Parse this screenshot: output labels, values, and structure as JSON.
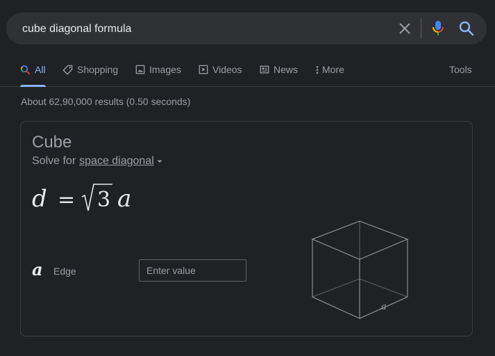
{
  "search": {
    "query": "cube diagonal formula"
  },
  "tabs": [
    {
      "label": "All",
      "icon": "search-icon",
      "active": true
    },
    {
      "label": "Shopping",
      "icon": "tag-icon",
      "active": false
    },
    {
      "label": "Images",
      "icon": "image-icon",
      "active": false
    },
    {
      "label": "Videos",
      "icon": "video-icon",
      "active": false
    },
    {
      "label": "News",
      "icon": "news-icon",
      "active": false
    },
    {
      "label": "More",
      "icon": "more-vert-icon",
      "active": false
    }
  ],
  "tools_label": "Tools",
  "result_stats": "About 62,90,000 results (0.50 seconds)",
  "calculator": {
    "title": "Cube",
    "solve_prefix": "Solve for",
    "solve_target": "space diagonal",
    "formula": {
      "lhs": "d",
      "equals": "=",
      "radicand": "3",
      "rhs_var": "a"
    },
    "variable": {
      "symbol": "a",
      "label": "Edge",
      "placeholder": "Enter value"
    },
    "diagram_label": "a"
  },
  "colors": {
    "background": "#202124",
    "search_bar": "#303134",
    "accent": "#8ab4f8"
  }
}
